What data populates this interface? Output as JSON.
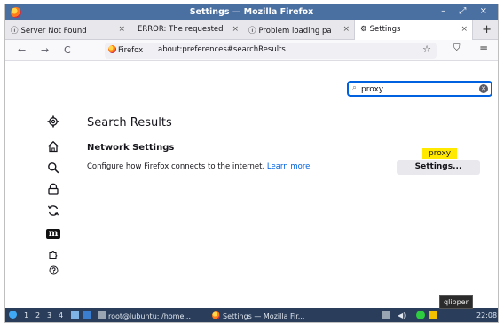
{
  "window": {
    "title": "Settings — Mozilla Firefox",
    "controls": "– ⤢ ×"
  },
  "tabs": [
    {
      "icon": "info-circle-icon",
      "label": "Server Not Found",
      "close": "×"
    },
    {
      "icon": "none",
      "label": "ERROR: The requested",
      "close": "×"
    },
    {
      "icon": "info-circle-icon",
      "label": "Problem loading pa",
      "close": "×"
    },
    {
      "icon": "gear-icon",
      "label": "Settings",
      "close": "×",
      "active": true
    }
  ],
  "new_tab": "+",
  "navbar": {
    "back": "←",
    "forward": "→",
    "reload": "C",
    "identity_chip": "Firefox",
    "url": "about:preferences#searchResults",
    "bookmark": "☆",
    "pocket": "⛉",
    "menu": "≡"
  },
  "search": {
    "value": "proxy",
    "placeholder": ""
  },
  "sidebar": [
    {
      "name": "general",
      "icon": "gear-icon"
    },
    {
      "name": "home",
      "icon": "home-icon"
    },
    {
      "name": "search",
      "icon": "search-icon"
    },
    {
      "name": "privacy",
      "icon": "lock-icon"
    },
    {
      "name": "sync",
      "icon": "sync-icon"
    },
    {
      "name": "more-from-mozilla",
      "icon": "mozilla-m-icon",
      "text": "m"
    },
    {
      "name": "extensions",
      "icon": "puzzle-icon"
    },
    {
      "name": "support",
      "icon": "help-icon"
    }
  ],
  "results": {
    "heading": "Search Results",
    "section_title": "Network Settings",
    "description": "Configure how Firefox connects to the internet.",
    "learn_more": "Learn more",
    "highlight": "proxy",
    "settings_button": "Settings..."
  },
  "taskbar": {
    "desktops": [
      "1",
      "2",
      "3",
      "4"
    ],
    "terminal_task": "root@lubuntu: /home...",
    "firefox_task": "Settings — Mozilla Fir...",
    "clock": "22:08",
    "tooltip": "qlipper"
  },
  "colors": {
    "titlebar": "#4a6fa1",
    "accent": "#0061e0",
    "highlight": "#ffe900",
    "taskbar": "#2a3d5a"
  }
}
